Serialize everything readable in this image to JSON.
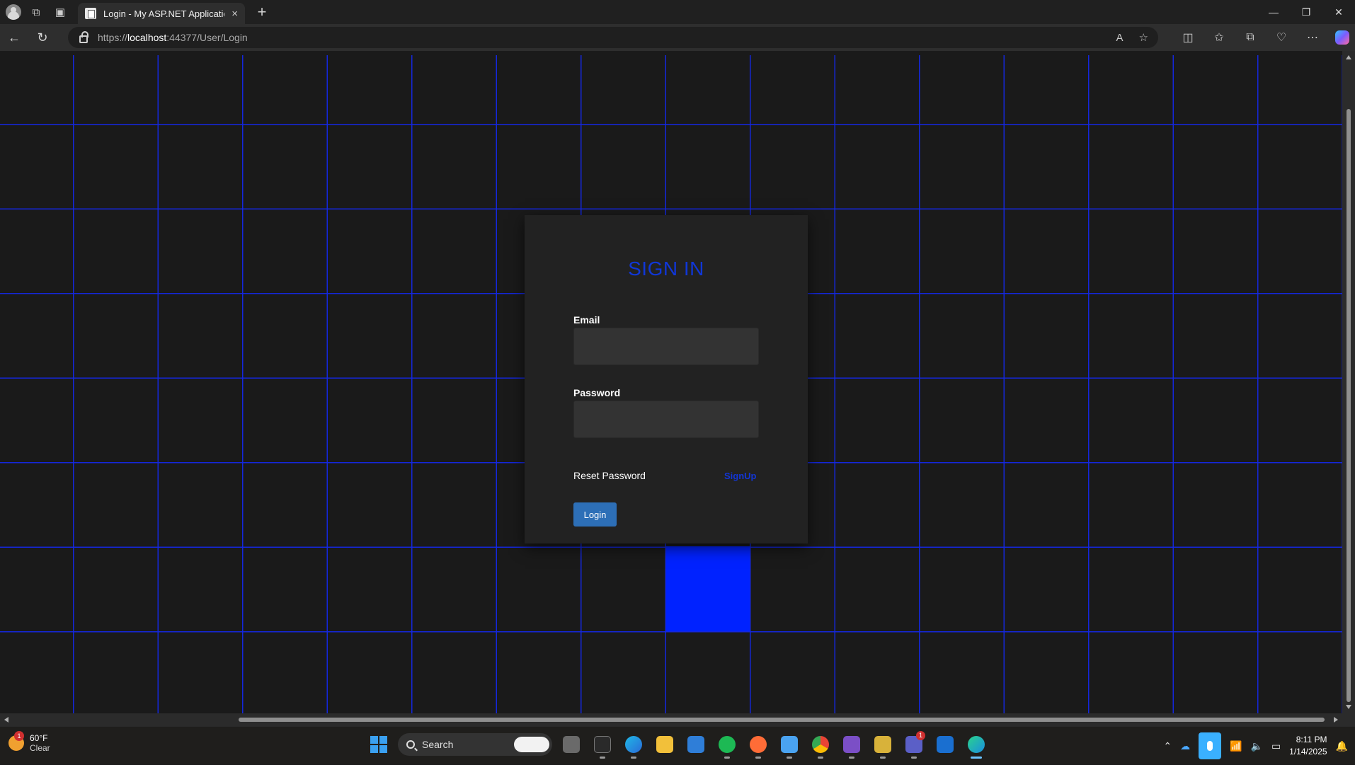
{
  "browser": {
    "tab_title": "Login - My ASP.NET Application",
    "tab_close": "×",
    "new_tab": "+",
    "url_scheme": "https://",
    "url_host": "localhost",
    "url_path": ":44377/User/Login",
    "window_controls": {
      "minimize": "—",
      "restore": "❐",
      "close": "✕"
    }
  },
  "page": {
    "heading": "SIGN IN",
    "email_label": "Email",
    "email_value": "",
    "password_label": "Password",
    "password_value": "",
    "reset_link": "Reset Password",
    "signup_link": "SignUp",
    "login_button": "Login",
    "colors": {
      "accent": "#1037d8",
      "grid": "#1428e6",
      "button": "#2d6fb7",
      "highlight_cell": "#0022ff"
    }
  },
  "taskbar": {
    "weather_temp": "60°F",
    "weather_cond": "Clear",
    "weather_badge": "1",
    "search_label": "Search",
    "teams_badge": "1",
    "time": "8:11 PM",
    "date": "1/14/2025"
  }
}
